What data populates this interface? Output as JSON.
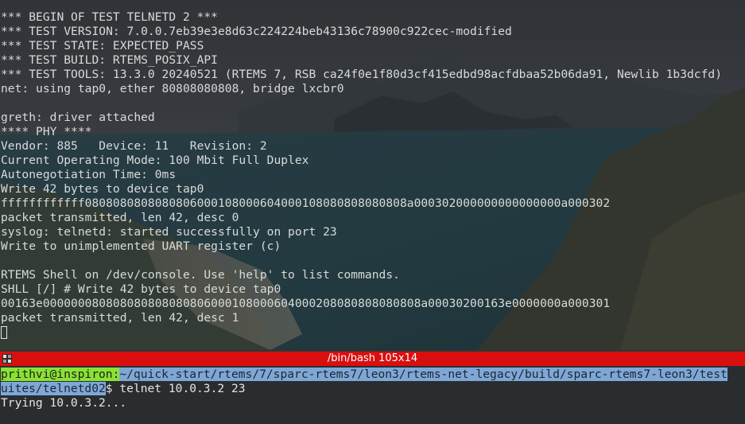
{
  "top_terminal": {
    "lines": [
      "*** BEGIN OF TEST TELNETD 2 ***",
      "*** TEST VERSION: 7.0.0.7eb39e3e8d63c224224beb43136c78900c922cec-modified",
      "*** TEST STATE: EXPECTED_PASS",
      "*** TEST BUILD: RTEMS_POSIX_API",
      "*** TEST TOOLS: 13.3.0 20240521 (RTEMS 7, RSB ca24f0e1f80d3cf415edbd98acfdbaa52b06da91, Newlib 1b3dcfd)",
      "net: using tap0, ether 80808080808, bridge lxcbr0",
      "",
      "greth: driver attached",
      "**** PHY ****",
      "Vendor: 885   Device: 11   Revision: 2",
      "Current Operating Mode: 100 Mbit Full Duplex",
      "Autonegotiation Time: 0ms",
      "Write 42 bytes to device tap0",
      "ffffffffffff0808080808080806000108000604000108080808080808a000302000000000000000a000302",
      "packet transmitted, len 42, desc 0",
      "syslog: telnetd: started successfully on port 23",
      "Write to unimplemented UART register (c)",
      "",
      "RTEMS Shell on /dev/console. Use 'help' to list commands.",
      "SHLL [/] # Write 42 bytes to device tap0",
      "00163e000000080808080808080806000108000604000208080808080808a00030200163e0000000a000301",
      "packet transmitted, len 42, desc 1"
    ]
  },
  "divider": {
    "title": "/bin/bash 105x14"
  },
  "bottom_terminal": {
    "prompt_user_host": "prithvi@inspiron",
    "prompt_colon": ":",
    "prompt_path_line1": "~/quick-start/rtems/7/sparc-rtems7/leon3/rtems-net-legacy/build/sparc-rtems7-leon3/test",
    "prompt_path_line2": "uites/telnetd02",
    "prompt_command": "$ telnet 10.0.3.2 23",
    "output_line": "Trying 10.0.3.2..."
  }
}
